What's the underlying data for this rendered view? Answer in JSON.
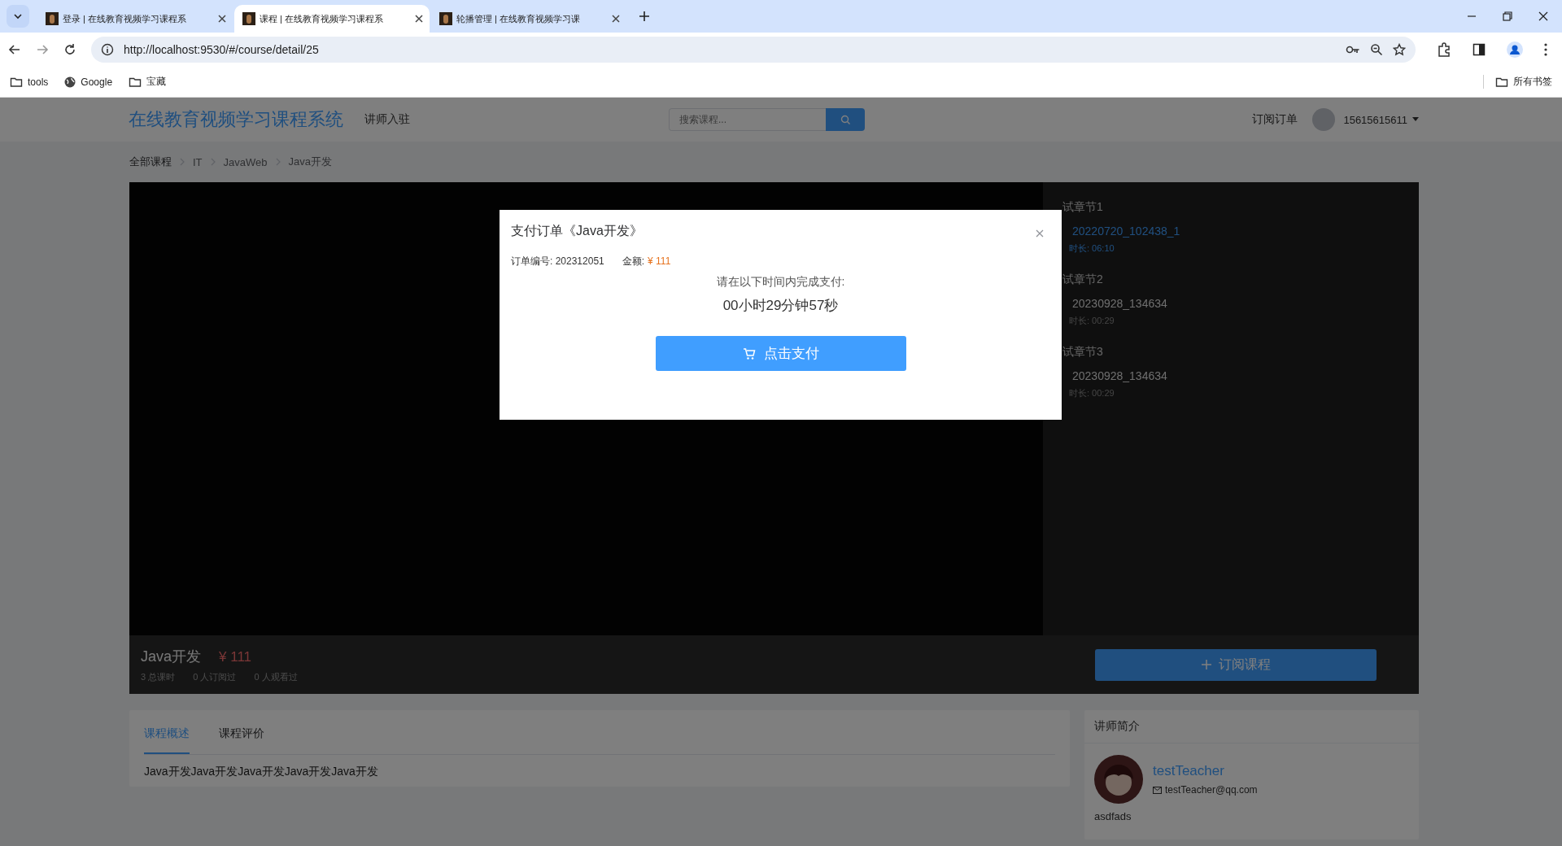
{
  "browser": {
    "tabs": [
      {
        "title": "登录 | 在线教育视频学习课程系",
        "selected": false
      },
      {
        "title": "课程 | 在线教育视频学习课程系",
        "selected": true
      },
      {
        "title": "轮播管理 | 在线教育视频学习课",
        "selected": false
      }
    ],
    "url": "http://localhost:9530/#/course/detail/25",
    "bookmarks": [
      {
        "label": "tools",
        "kind": "folder"
      },
      {
        "label": "Google",
        "kind": "site"
      },
      {
        "label": "宝藏",
        "kind": "folder"
      }
    ],
    "all_bookmarks": "所有书签"
  },
  "header": {
    "logo": "在线教育视频学习课程系统",
    "nav_link": "讲师入驻",
    "search": {
      "placeholder": "搜索课程..."
    },
    "orders_link": "订阅订单",
    "user": "15615615611"
  },
  "breadcrumb": [
    "全部课程",
    "IT",
    "JavaWeb",
    "Java开发"
  ],
  "chapters": [
    {
      "title": "试章节1",
      "lessons": [
        {
          "name": "20220720_102438_1",
          "duration": "时长: 06:10",
          "selected": true
        }
      ]
    },
    {
      "title": "试章节2",
      "lessons": [
        {
          "name": "20230928_134634",
          "duration": "时长: 00:29",
          "selected": false
        }
      ]
    },
    {
      "title": "试章节3",
      "lessons": [
        {
          "name": "20230928_134634",
          "duration": "时长: 00:29",
          "selected": false
        }
      ]
    }
  ],
  "course": {
    "title": "Java开发",
    "price": "¥ 111",
    "stats": [
      "3 总课时",
      "0 人订阅过",
      "0 人观看过"
    ],
    "subscribe_button": "订阅课程"
  },
  "detail_tabs": [
    {
      "label": "课程概述",
      "selected": true
    },
    {
      "label": "课程评价",
      "selected": false
    }
  ],
  "description": "Java开发Java开发Java开发Java开发Java开发",
  "teacher": {
    "heading": "讲师简介",
    "name": "testTeacher",
    "email": "testTeacher@qq.com",
    "bio": "asdfads"
  },
  "modal": {
    "title": "支付订单《Java开发》",
    "order_no": "订单编号: 202312051",
    "amount_label": "金额:",
    "amount": "¥ 111",
    "prompt": "请在以下时间内完成支付:",
    "countdown": "00小时29分钟57秒",
    "pay_button": "点击支付"
  }
}
